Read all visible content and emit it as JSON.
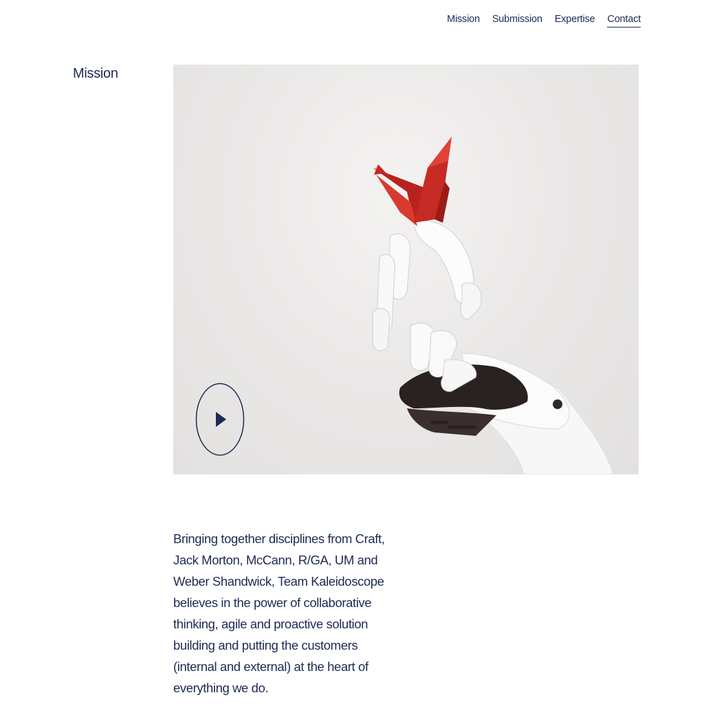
{
  "nav": {
    "items": [
      {
        "label": "Mission",
        "active": false
      },
      {
        "label": "Submission",
        "active": false
      },
      {
        "label": "Expertise",
        "active": false
      },
      {
        "label": "Contact",
        "active": true
      }
    ]
  },
  "section": {
    "title": "Mission"
  },
  "media": {
    "image": "robotic-hand-holding-red-origami-crane",
    "play_icon": "play-icon"
  },
  "body": {
    "text": "Bringing together disciplines from Craft, Jack Morton, McCann, R/GA, UM and Weber Shandwick, Team Kaleidoscope believes in the power of collaborative thinking, agile and proactive solution building and putting the customers (internal and external) at the heart of everything we do."
  },
  "colors": {
    "primary": "#1e2a55",
    "crane": "#c62a24",
    "background": "#ffffff"
  }
}
